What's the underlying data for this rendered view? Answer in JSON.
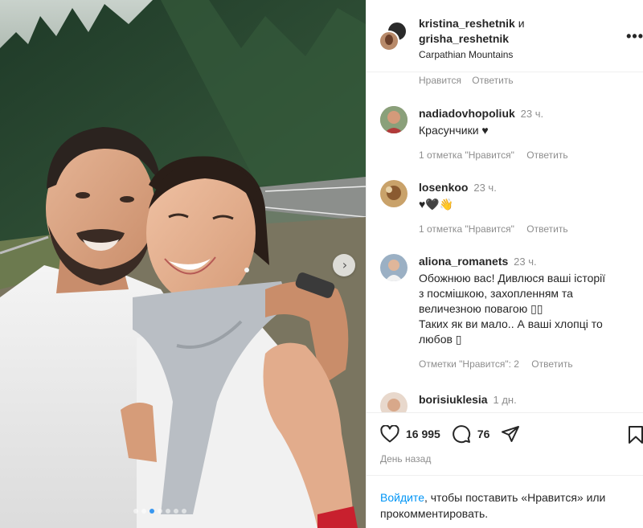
{
  "post": {
    "author_1": "kristina_reshetnik",
    "conj": "и",
    "author_2": "grisha_reshetnik",
    "location": "Carpathian Mountains",
    "more_icon": "more-horizontal-icon"
  },
  "previous_comment_actions": {
    "like": "Нравится",
    "reply": "Ответить"
  },
  "comments": [
    {
      "user": "nadiadovhopoliuk",
      "time": "23 ч.",
      "text": "Красунчики ♥",
      "likes": "1 отметка \"Нравится\"",
      "reply": "Ответить"
    },
    {
      "user": "losenkoo",
      "time": "23 ч.",
      "text": "♥🖤👋",
      "likes": "1 отметка \"Нравится\"",
      "reply": "Ответить"
    },
    {
      "user": "aliona_romanets",
      "time": "23 ч.",
      "text_lines": [
        "Обожнюю вас! Дивлюся ваші історії",
        "з посмішкою, захопленням та",
        "величезною повагою ▯▯",
        "Таких як ви мало.. А ваші хлопці то",
        "любов ▯"
      ],
      "likes": "Отметки \"Нравится\": 2",
      "reply": "Ответить"
    },
    {
      "user": "borisiuklesia",
      "time": "1 дн."
    }
  ],
  "actions": {
    "like_icon": "heart-icon",
    "like_count": "16 995",
    "comment_icon": "comment-icon",
    "comment_count": "76",
    "share_icon": "share-icon",
    "bookmark_icon": "bookmark-icon",
    "posted": "День назад"
  },
  "login": {
    "link": "Войдите",
    "rest": ", чтобы поставить «Нравится» или прокомментировать."
  },
  "carousel": {
    "next_icon": "chevron-right-icon",
    "slides": 7,
    "active_slide": 2
  },
  "colors": {
    "link_blue": "#0095f6",
    "muted": "#8e8e8e",
    "text": "#262626",
    "dot_active": "#3897f0"
  }
}
